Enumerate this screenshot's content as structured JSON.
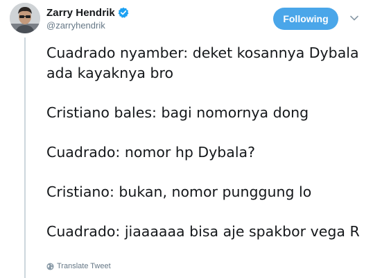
{
  "author": {
    "display_name": "Zarry Hendrik",
    "handle": "@zarryhendrik",
    "verified_icon": "verified-badge-icon"
  },
  "follow_button": {
    "label": "Following"
  },
  "menu": {
    "icon": "chevron-down-icon"
  },
  "tweet": {
    "lines": [
      "Cuadrado nyamber: deket kosannya Dybala ada kayaknya bro",
      "Cristiano bales: bagi nomornya dong",
      "Cuadrado: nomor hp Dybala?",
      "Cristiano: bukan, nomor punggung lo",
      "Cuadrado: jiaaaaaa bisa aje spakbor vega R"
    ]
  },
  "translate": {
    "label": "Translate Tweet",
    "icon": "globe-icon"
  },
  "colors": {
    "accent": "#4aa6e9",
    "muted_text": "#657786",
    "primary_text": "#14171a",
    "thread_line": "#ccd6dd"
  }
}
